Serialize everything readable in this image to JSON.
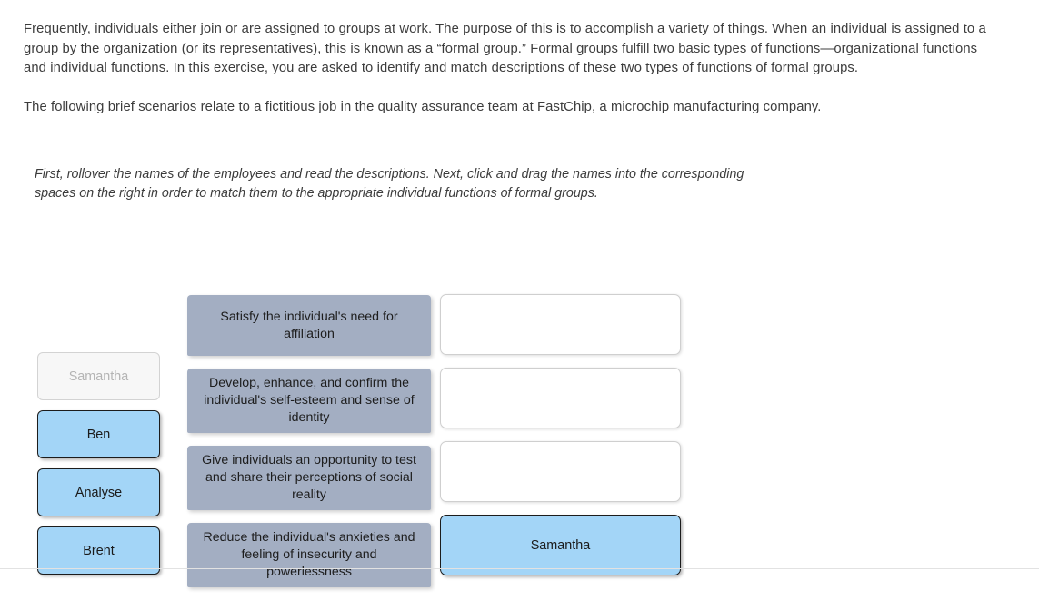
{
  "intro": {
    "paragraph_1": "Frequently, individuals either join or are assigned to groups at work. The purpose of this is to accomplish a variety of things. When an individual is assigned to a group by the organization (or its representatives), this is known as a “formal group.” Formal groups fulfill two basic types of functions—organizational functions and individual functions. In this exercise, you are asked to identify and match descriptions of these two types of functions of formal groups.",
    "paragraph_2": "The following brief scenarios relate to a fictitious job in the quality assurance team at FastChip, a microchip manufacturing company.",
    "instructions": "First, rollover the names of the employees and read the descriptions. Next, click and drag the names into the corresponding spaces on the right in order to match them to the appropriate individual functions of formal groups."
  },
  "exercise": {
    "names": [
      {
        "label": "Samantha",
        "state": "used"
      },
      {
        "label": "Ben",
        "state": "active"
      },
      {
        "label": "Analyse",
        "state": "active"
      },
      {
        "label": "Brent",
        "state": "active"
      }
    ],
    "descriptions": [
      "Satisfy the individual's need for affiliation",
      "Develop, enhance, and confirm the individual's self-esteem and sense of identity",
      "Give individuals an opportunity to test and share their perceptions of social reality",
      "Reduce the individual's anxieties and feeling of insecurity and powerlessness"
    ],
    "drop_zones": [
      {
        "label": "",
        "state": "empty"
      },
      {
        "label": "",
        "state": "empty"
      },
      {
        "label": "",
        "state": "empty"
      },
      {
        "label": "Samantha",
        "state": "filled"
      }
    ]
  },
  "colors": {
    "name_card_active": "#a3d5f7",
    "name_card_used_bg": "#f7f7f7",
    "description_card": "#a3aec2",
    "drop_zone_border": "#cfcfcf",
    "text": "#3c3c3c"
  }
}
